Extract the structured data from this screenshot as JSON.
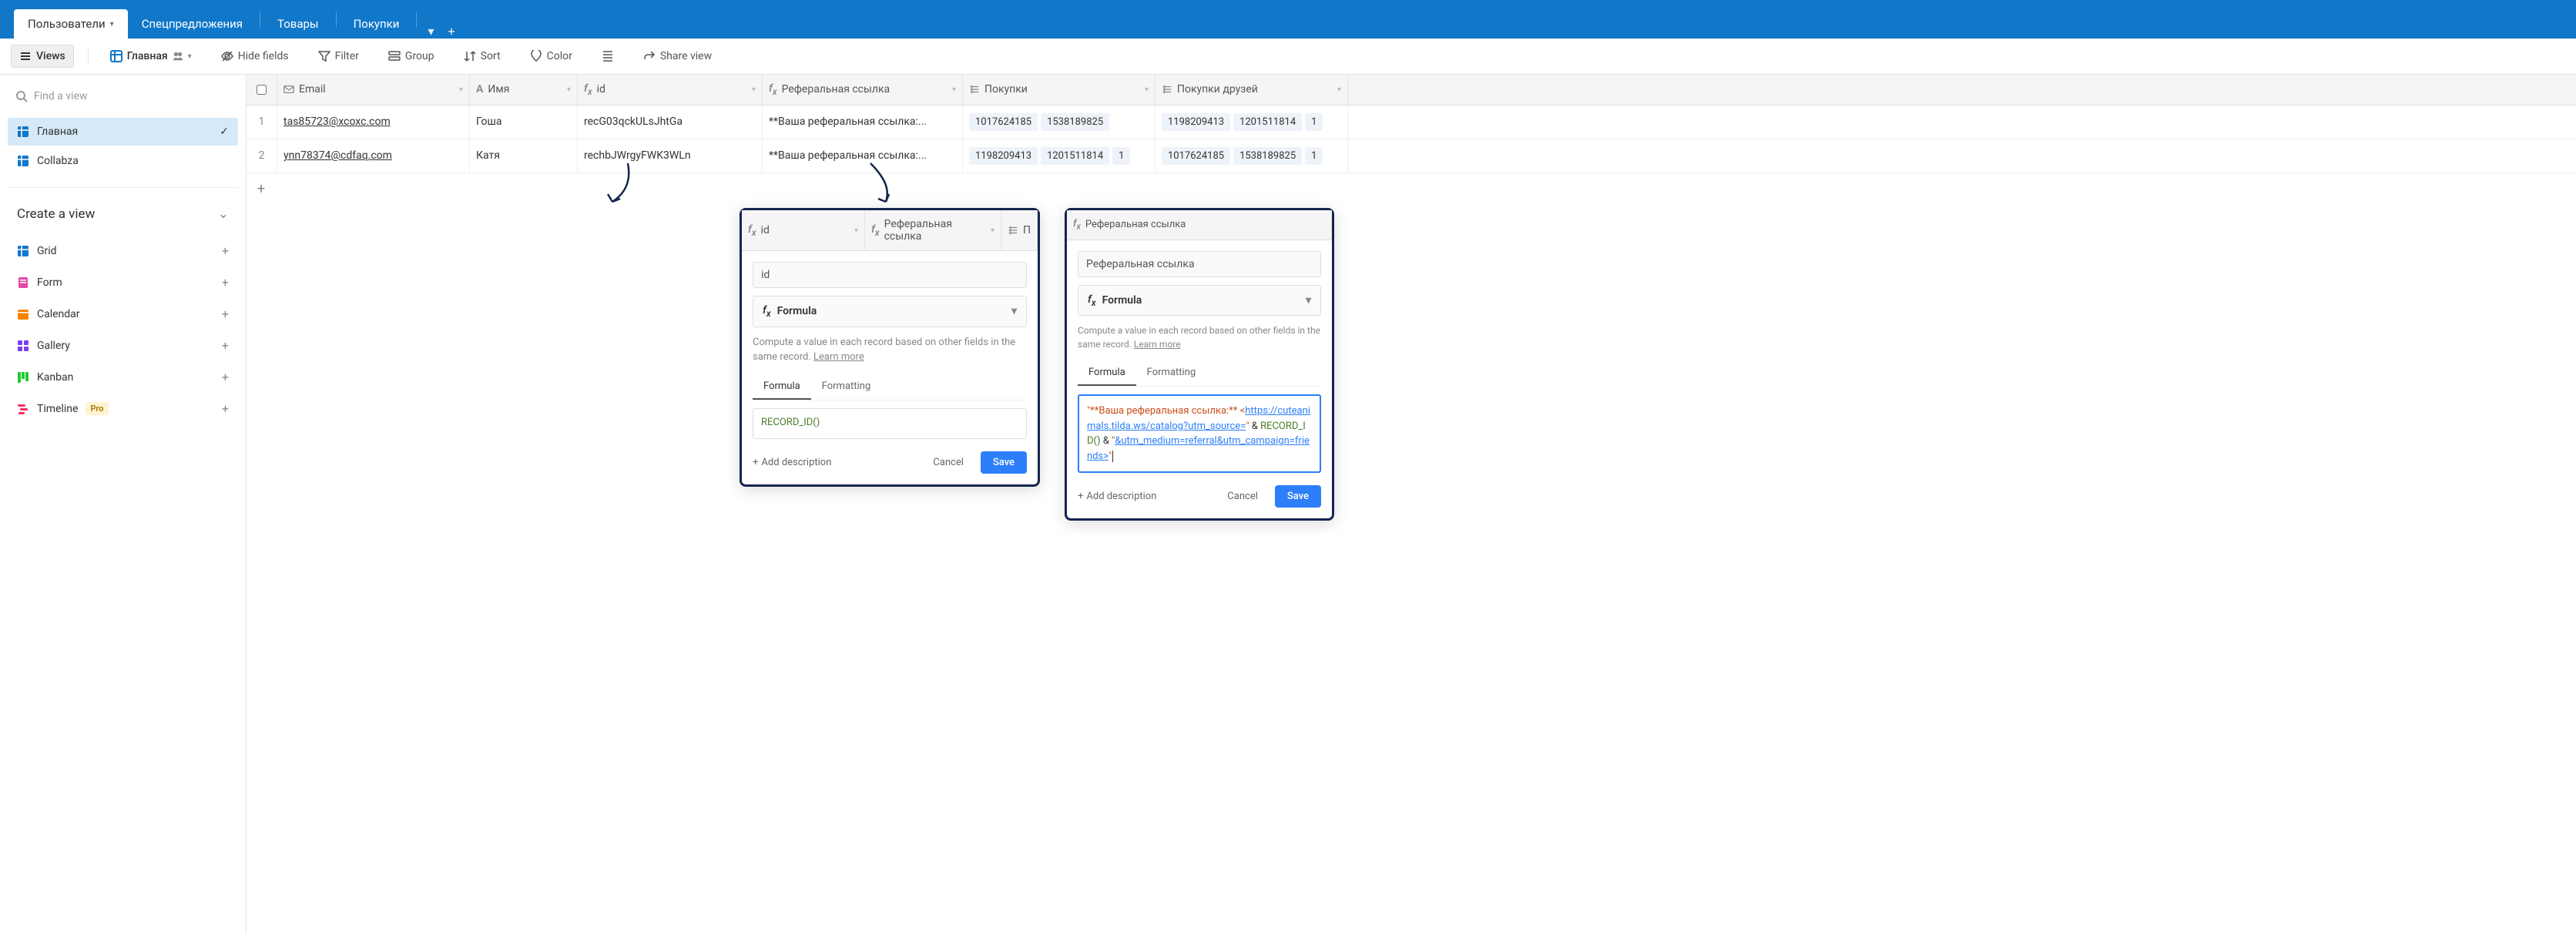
{
  "topnav": {
    "tabs": [
      "Пользователи",
      "Спецпредложения",
      "Товары",
      "Покупки"
    ],
    "active_index": 0
  },
  "toolbar": {
    "views": "Views",
    "primary_view": "Главная",
    "hide_fields": "Hide fields",
    "filter": "Filter",
    "group": "Group",
    "sort": "Sort",
    "color": "Color",
    "share": "Share view"
  },
  "sidebar": {
    "search_placeholder": "Find a view",
    "views": [
      {
        "label": "Главная",
        "active": true
      },
      {
        "label": "Collabza",
        "active": false
      }
    ],
    "create_title": "Create a view",
    "create_items": [
      {
        "label": "Grid",
        "color": "i-grid-blue"
      },
      {
        "label": "Form",
        "color": "i-form-pink"
      },
      {
        "label": "Calendar",
        "color": "i-cal-orange"
      },
      {
        "label": "Gallery",
        "color": "i-gal-purple"
      },
      {
        "label": "Kanban",
        "color": "i-kanban-green"
      },
      {
        "label": "Timeline",
        "color": "i-timeline-red",
        "pro": true
      }
    ],
    "pro_badge": "Pro"
  },
  "grid": {
    "columns": {
      "email": "Email",
      "name": "Имя",
      "id": "id",
      "ref": "Реферальная ссылка",
      "buy": "Покупки",
      "buyf": "Покупки друзей"
    },
    "rows": [
      {
        "num": "1",
        "email": "tas85723@xcoxc.com",
        "name": "Гоша",
        "id": "recG03qckULsJhtGa",
        "ref": "**Ваша реферальная ссылка:...",
        "buy": [
          "1017624185",
          "1538189825"
        ],
        "buyf": [
          "1198209413",
          "1201511814",
          "1"
        ]
      },
      {
        "num": "2",
        "email": "ynn78374@cdfaq.com",
        "name": "Катя",
        "id": "rechbJWrgyFWK3WLn",
        "ref": "**Ваша реферальная ссылка:...",
        "buy": [
          "1198209413",
          "1201511814",
          "1"
        ],
        "buyf": [
          "1017624185",
          "1538189825",
          "1"
        ]
      }
    ]
  },
  "popover_common": {
    "formula_type": "Formula",
    "desc_prefix": "Compute a value in each record based on other fields in the same record. ",
    "desc_link": "Learn more",
    "tab_formula": "Formula",
    "tab_formatting": "Formatting",
    "add_desc": "Add description",
    "cancel": "Cancel",
    "save": "Save"
  },
  "pop1": {
    "header_col1": "id",
    "header_col2": "Реферальная ссылка",
    "header_col3": "П",
    "field_name": "id",
    "formula": "RECORD_ID()"
  },
  "pop2": {
    "header": "Реферальная ссылка",
    "field_name": "Реферальная ссылка",
    "formula_parts": {
      "str1": "\"**Ваша реферальная ссылка:** <",
      "url1": "https://cuteanimals.tilda.ws/catalog?utm_source=",
      "str1b": "\"",
      "op1": " & ",
      "fn": "RECORD_ID()",
      "op2": " & ",
      "str2": "\"",
      "url2": "&utm_medium=referral&utm_campaign=friends>",
      "str2b": "\""
    }
  }
}
